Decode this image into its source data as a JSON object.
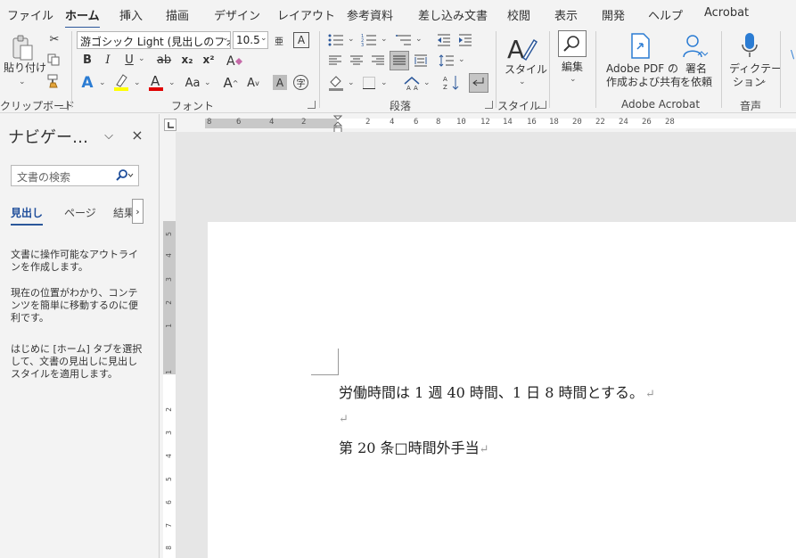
{
  "menu": {
    "tabs": [
      "ファイル",
      "ホーム",
      "挿入",
      "描画",
      "デザイン",
      "レイアウト",
      "参考資料",
      "差し込み文書",
      "校閲",
      "表示",
      "開発",
      "ヘルプ",
      "Acrobat"
    ],
    "active": "ホーム"
  },
  "ribbon": {
    "clipboard": {
      "paste_label": "貼り付け",
      "group_label": "クリップボード"
    },
    "font": {
      "font_name": "游ゴシック Light (見出しのフォン",
      "font_size": "10.5",
      "bold": "B",
      "italic": "I",
      "underline": "U",
      "strike": "ab",
      "subscript": "x₂",
      "superscript": "x²",
      "change_case": "Aa",
      "group_label": "フォント"
    },
    "paragraph": {
      "group_label": "段落"
    },
    "styles": {
      "label": "スタイル",
      "group_label": "スタイル"
    },
    "editing": {
      "label": "編集"
    },
    "acrobat": {
      "create_share_label_1": "Adobe PDF の",
      "create_share_label_2": "作成および共有",
      "sign_label_1": "署名",
      "sign_label_2": "を依頼",
      "group_label": "Adobe Acrobat"
    },
    "voice": {
      "dictate_label_1": "ディクテー",
      "dictate_label_2": "ション",
      "group_label": "音声"
    }
  },
  "ruler": {
    "horizontal_ticks": [
      "8",
      "6",
      "4",
      "2",
      "",
      "2",
      "4",
      "6",
      "8",
      "10",
      "12",
      "14",
      "16",
      "18",
      "20",
      "22",
      "24",
      "26",
      "28"
    ],
    "vertical_ticks": [
      "5",
      "4",
      "3",
      "2",
      "1",
      "",
      "1",
      "2",
      "3",
      "4",
      "5",
      "6",
      "7",
      "8"
    ]
  },
  "navigation": {
    "title": "ナビゲー…",
    "search_placeholder": "文書の検索",
    "tabs": [
      "見出し",
      "ページ",
      "結果"
    ],
    "help_1": "文書に操作可能なアウトラインを作成します。",
    "help_2": "現在の位置がわかり、コンテンツを簡単に移動するのに便利です。",
    "help_3": "はじめに [ホーム] タブを選択して、文書の見出しに見出しスタイルを適用します。"
  },
  "document": {
    "line_1": "労働時間は 1 週 40 時間、1 日 8 時間とする。",
    "line_2": "",
    "line_3": "第 20 条□時間外手当",
    "pilcrow": "↵"
  },
  "colors": {
    "accent": "#2b579a",
    "highlight": "#ffff00",
    "font_color": "#e00000",
    "text_effect": "#2b7cd3"
  }
}
